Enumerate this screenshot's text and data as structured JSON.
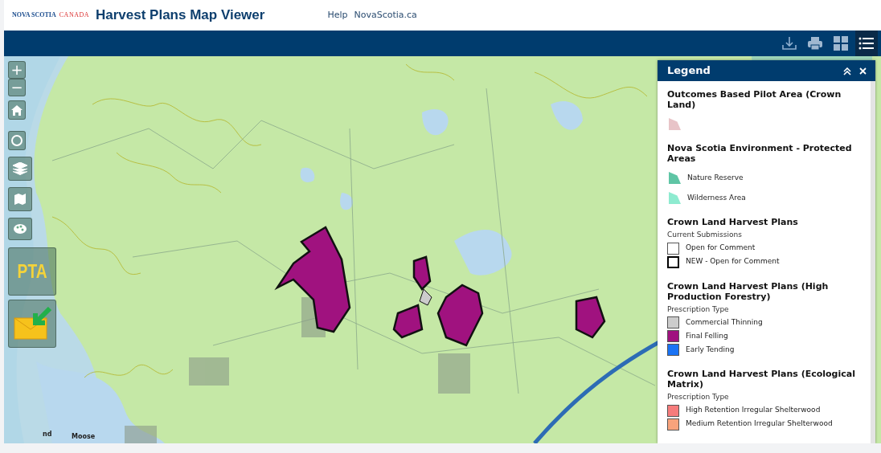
{
  "header": {
    "logo_main": "NOVA SCOTIA",
    "logo_sub": "CANADA",
    "title": "Harvest Plans Map Viewer",
    "links": [
      "Help",
      "NovaScotia.ca"
    ]
  },
  "map_tools": {
    "zoom_in": "+",
    "zoom_out": "−",
    "pta_label": "PTA"
  },
  "map_labels": [
    "nd",
    "Moose"
  ],
  "legend": {
    "title": "Legend",
    "sections": [
      {
        "title": "Outcomes Based Pilot Area (Crown Land)",
        "items": [
          {
            "kind": "polygon",
            "color": "#e8c4c8"
          }
        ]
      },
      {
        "title": "Nova Scotia Environment - Protected Areas",
        "items": [
          {
            "kind": "polygon",
            "label": "Nature Reserve",
            "color": "#5fc5a5"
          },
          {
            "kind": "polygon",
            "label": "Wilderness Area",
            "color": "#8eebd0"
          }
        ]
      },
      {
        "title": "Crown Land Harvest Plans",
        "subtitle": "Current Submissions",
        "items": [
          {
            "kind": "outline",
            "label": "Open for Comment",
            "color": "#555555"
          },
          {
            "kind": "thick",
            "label": "NEW - Open for Comment",
            "color": "#000000"
          }
        ]
      },
      {
        "title": "Crown Land Harvest Plans (High Production Forestry)",
        "subtitle": "Prescription Type",
        "items": [
          {
            "kind": "box",
            "label": "Commercial Thinning",
            "color": "#cccccc"
          },
          {
            "kind": "box",
            "label": "Final Felling",
            "color": "#a0127f"
          },
          {
            "kind": "box",
            "label": "Early Tending",
            "color": "#1a73f5"
          }
        ]
      },
      {
        "title": "Crown Land Harvest Plans (Ecological Matrix)",
        "subtitle": "Prescription Type",
        "items": [
          {
            "kind": "box",
            "label": "High Retention Irregular Shelterwood",
            "color": "#f67c7c"
          },
          {
            "kind": "box",
            "label": "Medium Retention Irregular Shelterwood",
            "color": "#f8a37c"
          }
        ]
      }
    ]
  }
}
